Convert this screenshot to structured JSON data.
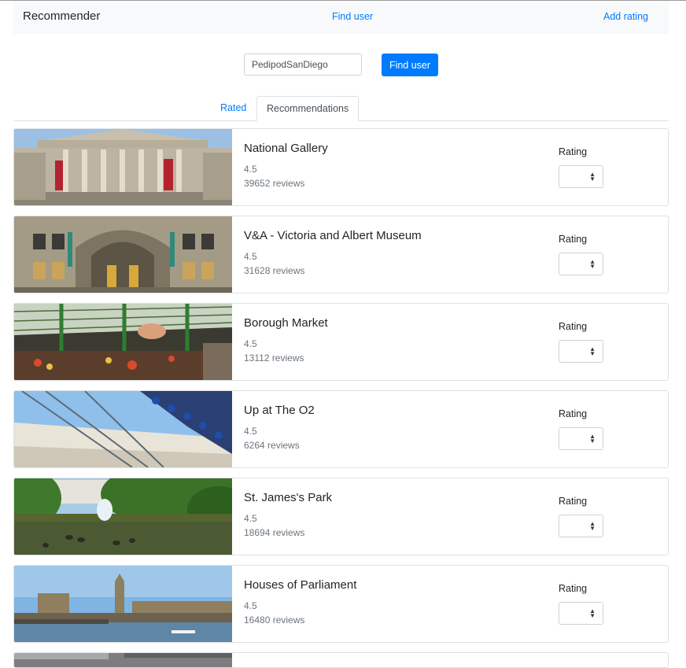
{
  "navbar": {
    "brand": "Recommender",
    "find_user_link": "Find user",
    "add_rating_link": "Add rating"
  },
  "search": {
    "value": "PedipodSanDiego",
    "button_label": "Find user"
  },
  "tabs": [
    {
      "label": "Rated",
      "active": false
    },
    {
      "label": "Recommendations",
      "active": true
    }
  ],
  "rating_label": "Rating",
  "items": [
    {
      "title": "National Gallery",
      "score": "4.5",
      "reviews": "39652 reviews",
      "image": "museum-facade"
    },
    {
      "title": "V&A - Victoria and Albert Museum",
      "score": "4.5",
      "reviews": "31628 reviews",
      "image": "museum-entrance"
    },
    {
      "title": "Borough Market",
      "score": "4.5",
      "reviews": "13112 reviews",
      "image": "market-hall"
    },
    {
      "title": "Up at The O2",
      "score": "4.5",
      "reviews": "6264 reviews",
      "image": "dome-climb"
    },
    {
      "title": "St. James's Park",
      "score": "4.5",
      "reviews": "18694 reviews",
      "image": "park-fountain"
    },
    {
      "title": "Houses of Parliament",
      "score": "4.5",
      "reviews": "16480 reviews",
      "image": "parliament-skyline"
    }
  ],
  "colors": {
    "accent": "#007bff",
    "navbar_bg": "#f8f9fa",
    "muted_text": "#6c757d",
    "border": "#dee2e6"
  }
}
